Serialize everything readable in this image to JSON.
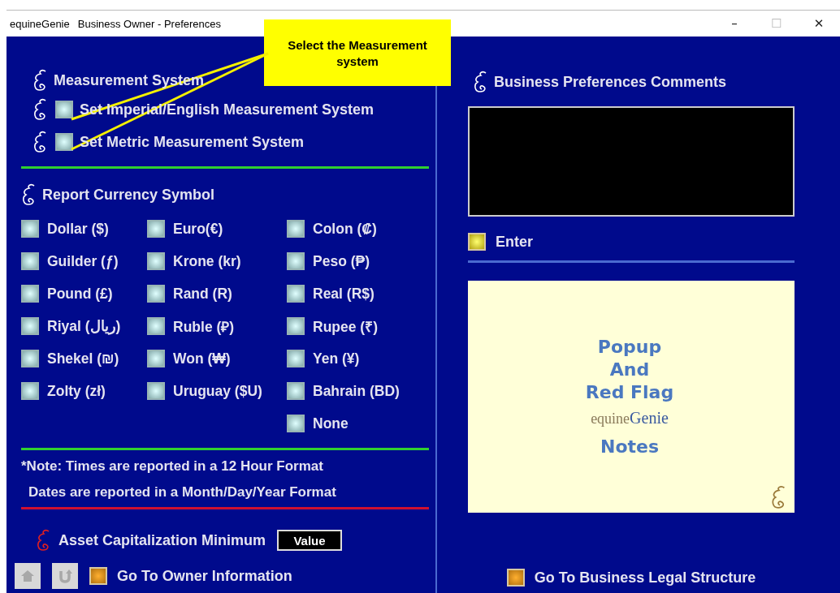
{
  "window": {
    "app_name": "equineGenie",
    "title": "Business Owner - Preferences",
    "controls": [
      "–",
      "☐",
      "✕"
    ]
  },
  "callout": {
    "text": "Select the Measurement system"
  },
  "measurement": {
    "heading": "Measurement System",
    "options": [
      {
        "label": "Set Imperial/English Measurement System",
        "checked": false
      },
      {
        "label": "Set Metric Measurement System",
        "checked": false
      }
    ]
  },
  "currency": {
    "heading": "Report Currency Symbol",
    "columns": [
      {
        "options": [
          {
            "label": "Dollar ($)",
            "checked": false
          },
          {
            "label": "Guilder (ƒ)",
            "checked": false
          },
          {
            "label": "Pound (£)",
            "checked": false
          },
          {
            "label": "Riyal (ريال)",
            "checked": false
          },
          {
            "label": "Shekel (₪)",
            "checked": false
          },
          {
            "label": "Zolty (zł)",
            "checked": false
          }
        ]
      },
      {
        "options": [
          {
            "label": "Euro(€)",
            "checked": false
          },
          {
            "label": "Krone (kr)",
            "checked": false
          },
          {
            "label": "Rand (R)",
            "checked": false
          },
          {
            "label": "Ruble (₽)",
            "checked": false
          },
          {
            "label": "Won (₩)",
            "checked": false
          },
          {
            "label": "Uruguay ($U)",
            "checked": false
          }
        ]
      },
      {
        "options": [
          {
            "label": "Colon  (₡)",
            "checked": false
          },
          {
            "label": "Peso (₱)",
            "checked": false
          },
          {
            "label": "Real (R$)",
            "checked": false
          },
          {
            "label": "Rupee (₹)",
            "checked": false
          },
          {
            "label": "Yen (¥)",
            "checked": false
          },
          {
            "label": "Bahrain (BD)",
            "checked": false
          },
          {
            "label": "None",
            "checked": false
          }
        ]
      }
    ]
  },
  "note": [
    "*Note: Times are reported in a 12 Hour Format",
    "Dates are reported in a Month/Day/Year Format"
  ],
  "asset": {
    "label": "Asset Capitalization Minimum",
    "value": "Value"
  },
  "footer_left": {
    "link": "Go To Owner Information"
  },
  "comments": {
    "heading": "Business Preferences Comments",
    "enter": "Enter"
  },
  "notes_panel": {
    "lines": [
      "Popup",
      "And",
      "Red Flag"
    ],
    "logo": [
      "equine",
      "Genie"
    ],
    "last": "Notes"
  },
  "footer_right": {
    "link": "Go To Business Legal Structure"
  }
}
